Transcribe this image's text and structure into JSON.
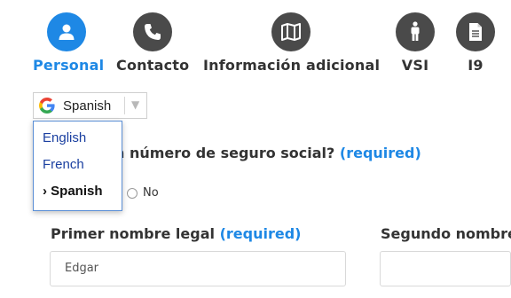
{
  "steps": [
    {
      "label": "Personal",
      "icon": "person-icon",
      "active": true
    },
    {
      "label": "Contacto",
      "icon": "phone-icon",
      "active": false
    },
    {
      "label": "Información adicional",
      "icon": "map-icon",
      "active": false
    },
    {
      "label": "VSI",
      "icon": "person-standing-icon",
      "active": false
    },
    {
      "label": "I9",
      "icon": "document-icon",
      "active": false
    }
  ],
  "translate": {
    "selected": "Spanish",
    "options": [
      "English",
      "French",
      "Spanish"
    ],
    "selected_marker": "›"
  },
  "question": {
    "text_visible": "n número de seguro social?",
    "required": "(required)"
  },
  "radio_no": {
    "label": "No"
  },
  "fields": {
    "first_name": {
      "label": "Primer nombre legal",
      "required": "(required)",
      "value": "Edgar"
    },
    "middle_name": {
      "label": "Segundo nombre",
      "value": ""
    }
  },
  "colors": {
    "accent": "#1e88e5",
    "icon_bg": "#4a4a4a",
    "link": "#1a3fa0"
  }
}
